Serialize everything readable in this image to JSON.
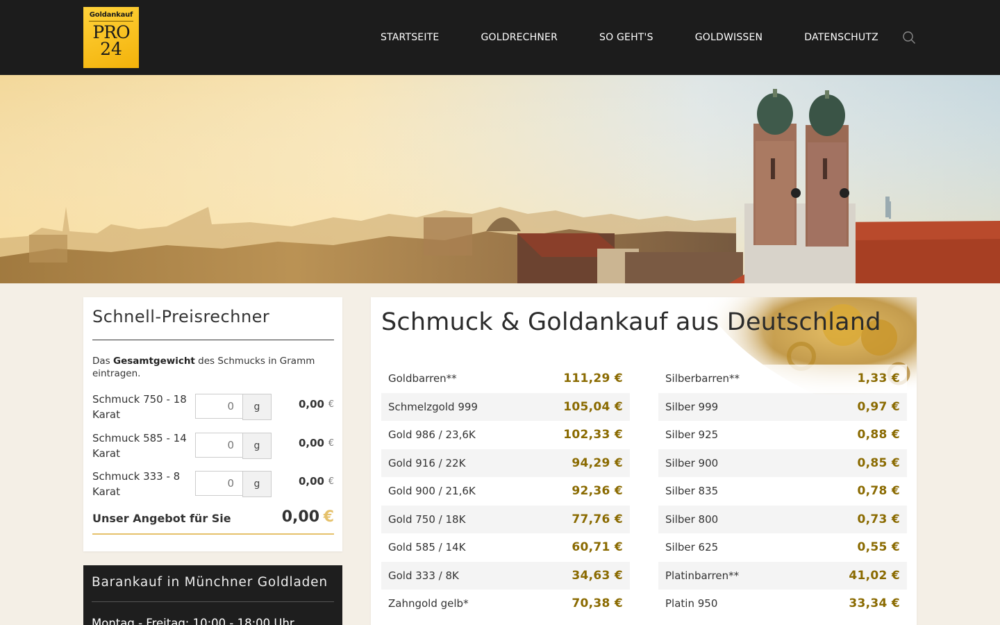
{
  "header": {
    "logo": {
      "top": "Goldankauf",
      "pro": "PRO",
      "num": "24"
    },
    "nav": [
      "STARTSEITE",
      "GOLDRECHNER",
      "SO GEHT'S",
      "GOLDWISSEN",
      "DATENSCHUTZ"
    ]
  },
  "calculator": {
    "title": "Schnell-Preisrechner",
    "intro_before": "Das ",
    "intro_bold": "Gesamtgewicht",
    "intro_after": " des Schmucks in Gramm eintragen.",
    "rows": [
      {
        "label": "Schmuck 750 - 18 Karat",
        "placeholder": "0",
        "unit": "g",
        "value": "0,00",
        "currency": "€"
      },
      {
        "label": "Schmuck 585 - 14 Karat",
        "placeholder": "0",
        "unit": "g",
        "value": "0,00",
        "currency": "€"
      },
      {
        "label": "Schmuck 333 - 8 Karat",
        "placeholder": "0",
        "unit": "g",
        "value": "0,00",
        "currency": "€"
      }
    ],
    "offer_label": "Unser Angebot für Sie",
    "offer_value": "0,00",
    "offer_currency": "€"
  },
  "store": {
    "title": "Barankauf in Münchner Goldladen",
    "hours": "Montag - Freitag: 10:00 - 18:00 Uhr"
  },
  "prices": {
    "title": "Schmuck & Goldankauf aus Deutschland",
    "left": [
      {
        "name": "Goldbarren**",
        "value": "111,29 €"
      },
      {
        "name": "Schmelzgold 999",
        "value": "105,04 €"
      },
      {
        "name": "Gold 986 / 23,6K",
        "value": "102,33 €"
      },
      {
        "name": "Gold 916 / 22K",
        "value": "94,29 €"
      },
      {
        "name": "Gold 900 / 21,6K",
        "value": "92,36 €"
      },
      {
        "name": "Gold 750 / 18K",
        "value": "77,76 €"
      },
      {
        "name": "Gold 585 / 14K",
        "value": "60,71 €"
      },
      {
        "name": "Gold 333 / 8K",
        "value": "34,63 €"
      },
      {
        "name": "Zahngold gelb*",
        "value": "70,38 €"
      }
    ],
    "right": [
      {
        "name": "Silberbarren**",
        "value": "1,33 €"
      },
      {
        "name": "Silber 999",
        "value": "0,97 €"
      },
      {
        "name": "Silber 925",
        "value": "0,88 €"
      },
      {
        "name": "Silber 900",
        "value": "0,85 €"
      },
      {
        "name": "Silber 835",
        "value": "0,78 €"
      },
      {
        "name": "Silber 800",
        "value": "0,73 €"
      },
      {
        "name": "Silber 625",
        "value": "0,55 €"
      },
      {
        "name": "Platinbarren**",
        "value": "41,02 €"
      },
      {
        "name": "Platin 950",
        "value": "33,34 €"
      }
    ]
  },
  "colors": {
    "header_bg": "#1c1c1c",
    "gold_value": "#8a6a00",
    "accent": "#e5c16b",
    "page_bg": "#f4efe6"
  }
}
